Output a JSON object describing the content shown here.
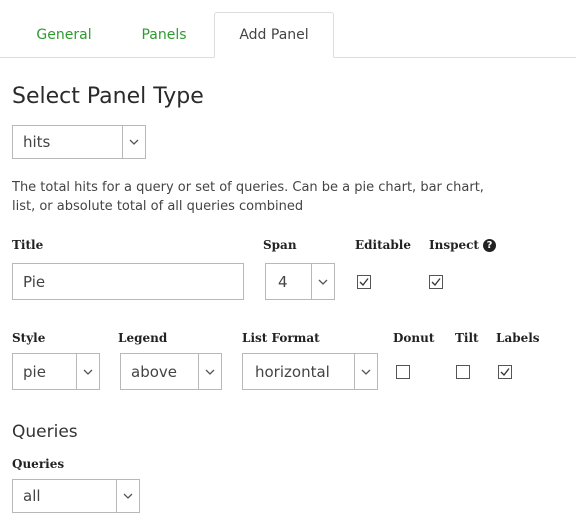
{
  "tabs": [
    {
      "label": "General",
      "active": false
    },
    {
      "label": "Panels",
      "active": false
    },
    {
      "label": "Add Panel",
      "active": true
    }
  ],
  "heading": "Select Panel Type",
  "panel_type": {
    "value": "hits"
  },
  "description_line1": "The total hits for a query or set of queries. Can be a pie chart, bar chart,",
  "description_line2": "list, or absolute total of all queries combined",
  "fields": {
    "title_label": "Title",
    "title_value": "Pie",
    "span_label": "Span",
    "span_value": "4",
    "editable_label": "Editable",
    "editable_checked": true,
    "inspect_label": "Inspect",
    "inspect_checked": true,
    "inspect_info_icon": "question-circle-icon"
  },
  "options": {
    "style_label": "Style",
    "style_value": "pie",
    "legend_label": "Legend",
    "legend_value": "above",
    "list_format_label": "List Format",
    "list_format_value": "horizontal",
    "donut_label": "Donut",
    "donut_checked": false,
    "tilt_label": "Tilt",
    "tilt_checked": false,
    "labels_label": "Labels",
    "labels_checked": true
  },
  "queries": {
    "section_title": "Queries",
    "label": "Queries",
    "value": "all"
  },
  "colors": {
    "tab_link": "#2e9b2e",
    "border": "#b8b8b8"
  }
}
